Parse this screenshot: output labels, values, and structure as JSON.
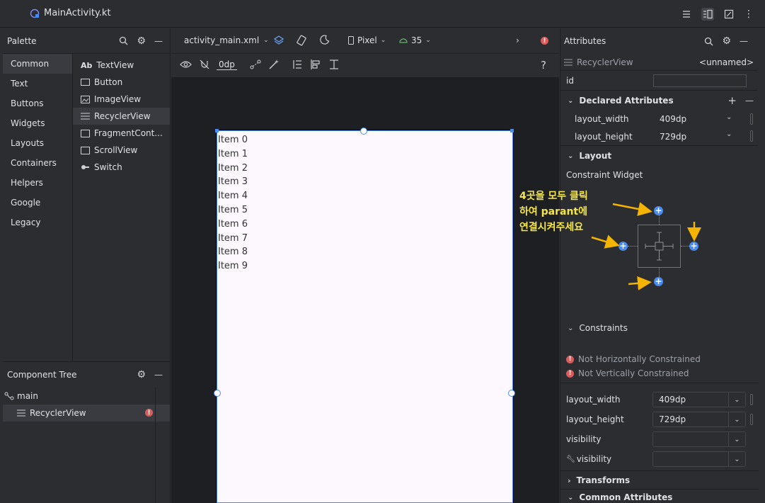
{
  "titlebar": {
    "filename": "MainActivity.kt"
  },
  "palette": {
    "title": "Palette",
    "categories": [
      "Common",
      "Text",
      "Buttons",
      "Widgets",
      "Layouts",
      "Containers",
      "Helpers",
      "Google",
      "Legacy"
    ],
    "selected_category": "Common",
    "items": [
      {
        "icon": "Ab",
        "label": "TextView"
      },
      {
        "icon": "button-icon",
        "label": "Button"
      },
      {
        "icon": "image-icon",
        "label": "ImageView"
      },
      {
        "icon": "list-icon",
        "label": "RecyclerView"
      },
      {
        "icon": "fragment-icon",
        "label": "FragmentCont..."
      },
      {
        "icon": "scroll-icon",
        "label": "ScrollView"
      },
      {
        "icon": "switch-icon",
        "label": "Switch"
      }
    ]
  },
  "component_tree": {
    "title": "Component Tree",
    "root": "main",
    "child": "RecyclerView"
  },
  "editor_toolbar": {
    "file": "activity_main.xml",
    "device": "Pixel",
    "api": "35",
    "margin": "0dp",
    "help": "?"
  },
  "device_preview": {
    "items": [
      "Item 0",
      "Item 1",
      "Item 2",
      "Item 3",
      "Item 4",
      "Item 5",
      "Item 6",
      "Item 7",
      "Item 8",
      "Item 9"
    ]
  },
  "attributes": {
    "title": "Attributes",
    "component": "RecyclerView",
    "component_name": "<unnamed>",
    "id_label": "id",
    "declared_header": "Declared Attributes",
    "declared": [
      {
        "name": "layout_width",
        "value": "409dp"
      },
      {
        "name": "layout_height",
        "value": "729dp"
      }
    ],
    "layout_header": "Layout",
    "constraint_widget": "Constraint Widget",
    "constraints_header": "Constraints",
    "warnings": [
      "Not Horizontally Constrained",
      "Not Vertically Constrained"
    ],
    "fields": [
      {
        "name": "layout_width",
        "value": "409dp"
      },
      {
        "name": "layout_height",
        "value": "729dp"
      },
      {
        "name": "visibility",
        "value": ""
      },
      {
        "name": "visibility",
        "value": ""
      }
    ],
    "transforms_header": "Transforms",
    "common_header": "Common Attributes"
  },
  "annotation": {
    "lines": [
      "4곳을 모두 클릭",
      "하여 parant에",
      "연결시켜주세요"
    ],
    "color": "#f5e64a",
    "arrow_color": "#f5b400"
  },
  "colors": {
    "accent": "#4a8bf0",
    "error": "#db5c5c",
    "device_bg": "#fdf7fe"
  }
}
